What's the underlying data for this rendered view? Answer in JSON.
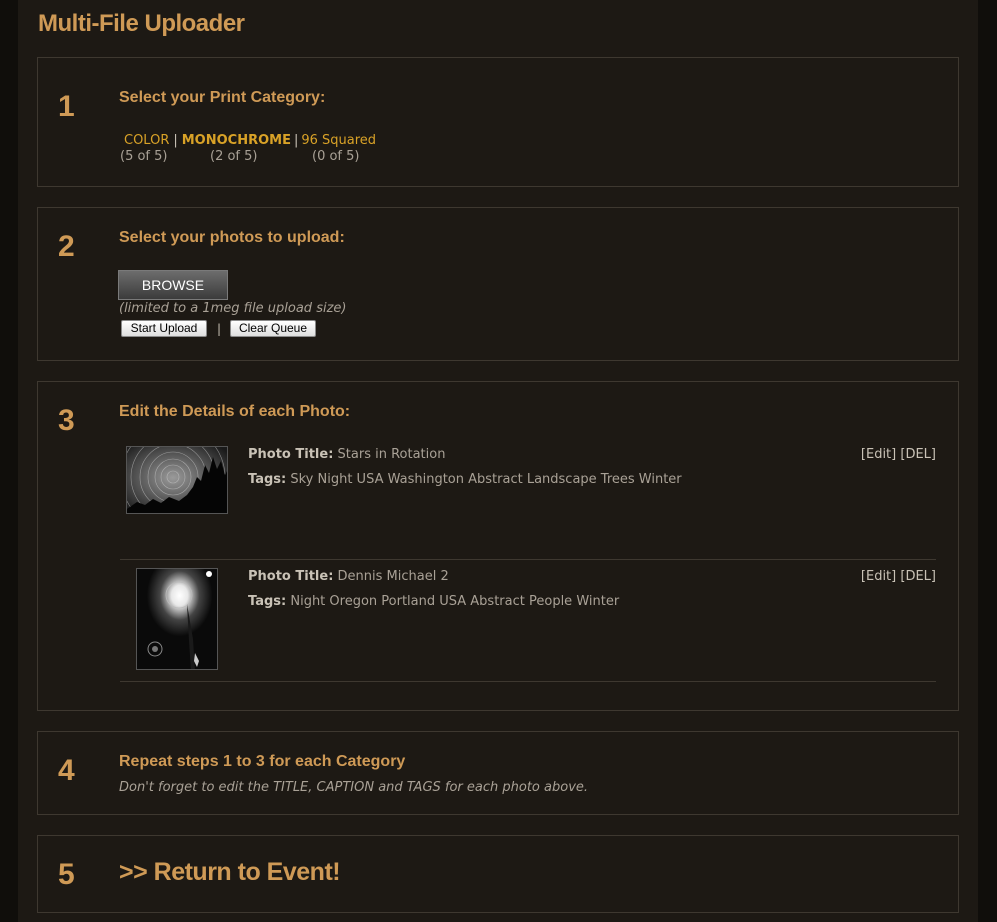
{
  "page": {
    "title": "Multi-File Uploader"
  },
  "steps": {
    "s1": {
      "number": "1",
      "heading": "Select your Print Category:",
      "categories": [
        {
          "label": "COLOR",
          "count": "(5 of 5)"
        },
        {
          "label": "MONOCHROME",
          "count": "(2 of 5)"
        },
        {
          "label": "96 Squared",
          "count": "(0 of 5)"
        }
      ],
      "separator": "|"
    },
    "s2": {
      "number": "2",
      "heading": "Select your photos to upload:",
      "browse_label": "BROWSE",
      "limit_note": "(limited to a 1meg file upload size)",
      "start_label": "Start Upload",
      "clear_label": "Clear Queue",
      "separator": "|"
    },
    "s3": {
      "number": "3",
      "heading": "Edit the Details of each Photo:",
      "title_label": "Photo Title:",
      "tags_label": "Tags:",
      "edit_label": "Edit",
      "del_label": "DEL",
      "photos": [
        {
          "title": "Stars in Rotation",
          "tags": "Sky Night USA Washington Abstract Landscape Trees Winter"
        },
        {
          "title": "Dennis Michael 2",
          "tags": "Night Oregon Portland USA Abstract People Winter"
        }
      ]
    },
    "s4": {
      "number": "4",
      "heading": "Repeat steps 1 to 3 for each Category",
      "reminder": "Don't forget to edit the TITLE, CAPTION and TAGS for each photo above."
    },
    "s5": {
      "number": "5",
      "link": ">> Return to Event!"
    }
  },
  "colors": {
    "accent": "#cf9a56",
    "category_link": "#d9a227",
    "panel_bg": "#1d1914",
    "panel_border": "#3e3830"
  }
}
